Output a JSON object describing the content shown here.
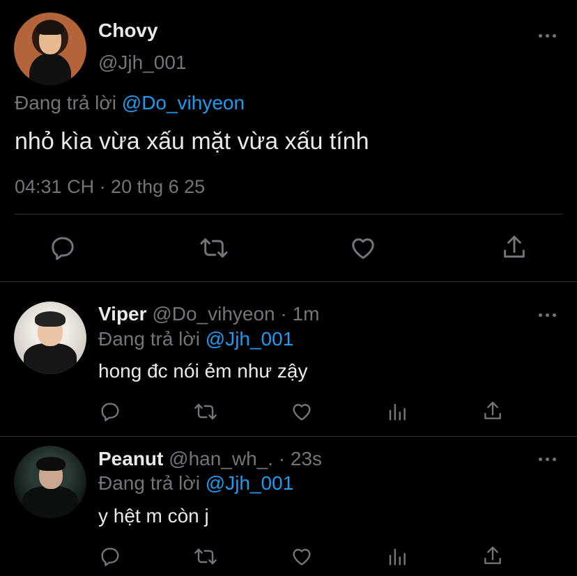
{
  "main_tweet": {
    "display_name": "Chovy",
    "handle": "@Jjh_001",
    "replying_prefix": "Đang trả lời",
    "replying_to": "@Do_vihyeon",
    "text": "nhỏ kìa vừa xấu mặt vừa xấu tính",
    "timestamp": "04:31 CH · 20 thg 6 25"
  },
  "replies": [
    {
      "display_name": "Viper",
      "handle_time": "@Do_vihyeon · 1m",
      "replying_prefix": "Đang trả lời",
      "replying_to": "@Jjh_001",
      "text": "hong đc nói ẻm như zậy"
    },
    {
      "display_name": "Peanut",
      "handle_time": "@han_wh_. · 23s",
      "replying_prefix": "Đang trả lời",
      "replying_to": "@Jjh_001",
      "text": "y hệt m còn j"
    }
  ],
  "colors": {
    "background": "#000000",
    "text": "#e7e9ea",
    "secondary": "#71767b",
    "link": "#1d9bf0",
    "divider": "#2f3336"
  }
}
